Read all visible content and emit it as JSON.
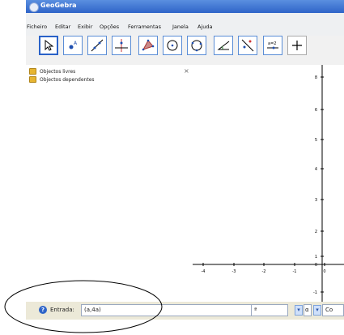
{
  "window": {
    "title": "GeoGebra"
  },
  "menu": [
    "Ficheiro",
    "Editar",
    "Exibir",
    "Opções",
    "Ferramentas",
    "Janela",
    "Ajuda"
  ],
  "toolbar": {
    "tools": [
      "move-tool-icon",
      "point-tool-icon",
      "line-tool-icon",
      "perpendicular-line-tool-icon",
      "polygon-tool-icon",
      "circle-tool-icon",
      "circle-three-points-tool-icon",
      "angle-tool-icon",
      "reflect-tool-icon",
      "slider-tool-icon",
      "move-view-tool-icon"
    ],
    "slider_label": "a=2"
  },
  "algebra": {
    "items": [
      {
        "label": "Objectos livres",
        "icon": "folder-icon"
      },
      {
        "label": "Objectos dependentes",
        "icon": "folder-icon"
      }
    ],
    "close_label": "×"
  },
  "graphics": {
    "y_ticks": [
      "8",
      "6",
      "5",
      "4",
      "3",
      "2",
      "1",
      "0",
      "-1"
    ],
    "x_ticks": [
      "-4",
      "-3",
      "-2",
      "-1",
      "0"
    ]
  },
  "input_bar": {
    "label": "Entrada:",
    "value": "(a,4a)",
    "symbol_combo": "ª",
    "greek_combo": "α",
    "command_combo": "Co"
  },
  "colors": {
    "title_bar": "#2f64c8",
    "tool_border": "#5a8dd6",
    "folder": "#e7b531"
  }
}
